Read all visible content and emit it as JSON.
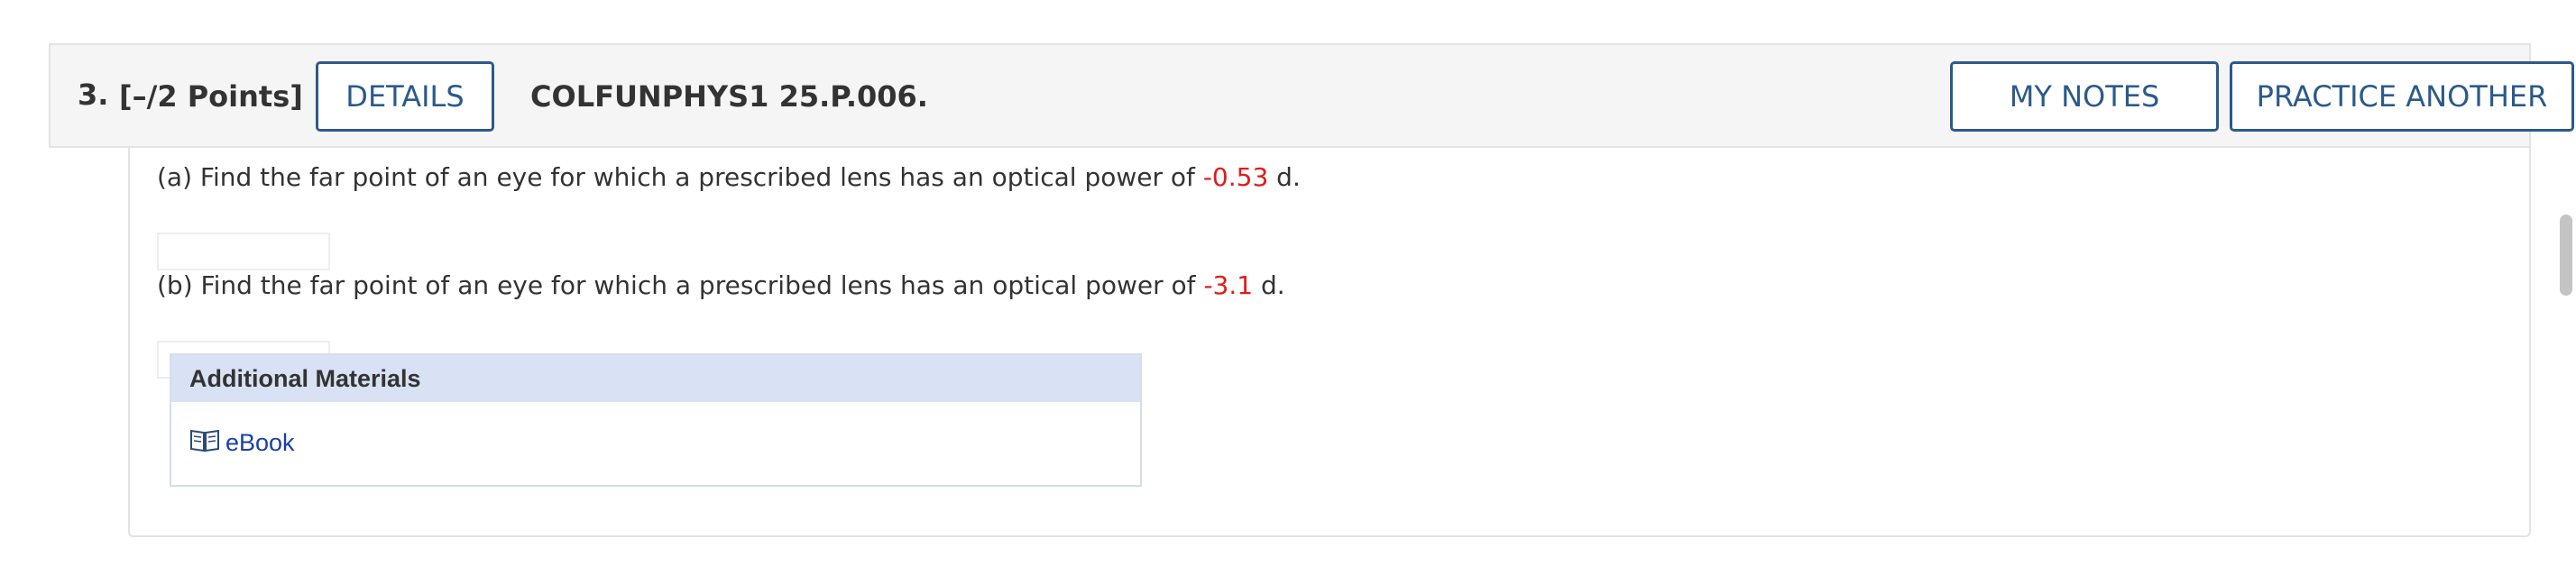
{
  "question": {
    "number": "3.",
    "points": "[–/2 Points]",
    "code": "COLFUNPHYS1 25.P.006.",
    "buttons": {
      "details": "DETAILS",
      "my_notes": "MY NOTES",
      "practice_another": "PRACTICE ANOTHER"
    }
  },
  "parts": [
    {
      "prefix": "(a) Find the far point of an eye for which a prescribed lens has an optical power of ",
      "value": "-0.53",
      "suffix": " d."
    },
    {
      "prefix": "(b) Find the far point of an eye for which a prescribed lens has an optical power of ",
      "value": "-3.1",
      "suffix": " d."
    }
  ],
  "additional_materials": {
    "title": "Additional Materials",
    "link_label": "eBook",
    "link_icon": "book-icon"
  },
  "colors": {
    "accent": "#2b5a8a",
    "value_red": "#e01b1b",
    "link_blue": "#1a3fa6",
    "materials_header_bg": "#d9e1f4"
  }
}
